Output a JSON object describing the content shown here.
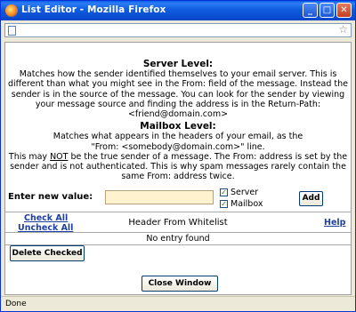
{
  "window": {
    "title": "List Editor - Mozilla Firefox",
    "minimize_glyph": "_",
    "maximize_glyph": "□",
    "close_glyph": "✕"
  },
  "icons": {
    "page": "page-icon",
    "star": "☆"
  },
  "server": {
    "heading": "Server Level:",
    "text": "Matches how the sender identified themselves to your email server. This is different than what you might see in the From: field of the message. Instead the sender is in the source of the message. You can look for the sender by viewing your message source and finding the address is in the Return-Path: <friend@domain.com>"
  },
  "mailbox": {
    "heading": "Mailbox Level:",
    "text1": "Matches what appears in the headers of your email, as the",
    "text2": "\"From: <somebody@domain.com>\" line.",
    "text3_a": "This may ",
    "text3_not": "NOT",
    "text3_b": " be the true sender of a message. The From: address is set by the sender and is not authenticated. This is why spam messages rarely contain the same From: address twice."
  },
  "entry": {
    "label": "Enter new value:",
    "value": "",
    "server_checkbox": {
      "label": "Server",
      "checked": true
    },
    "mailbox_checkbox": {
      "label": "Mailbox",
      "checked": true
    },
    "add_label": "Add",
    "check_mark": "✓"
  },
  "list": {
    "check_all": "Check All",
    "uncheck_all": "Uncheck All",
    "title": "Header From Whitelist",
    "help": "Help",
    "empty_text": "No entry found"
  },
  "buttons": {
    "delete": "Delete Checked",
    "close": "Close Window"
  },
  "status": {
    "text": "Done"
  },
  "colors": {
    "titlebar": "#0a5ee8",
    "input_background": "#fff3cf",
    "link": "#2040a0"
  }
}
